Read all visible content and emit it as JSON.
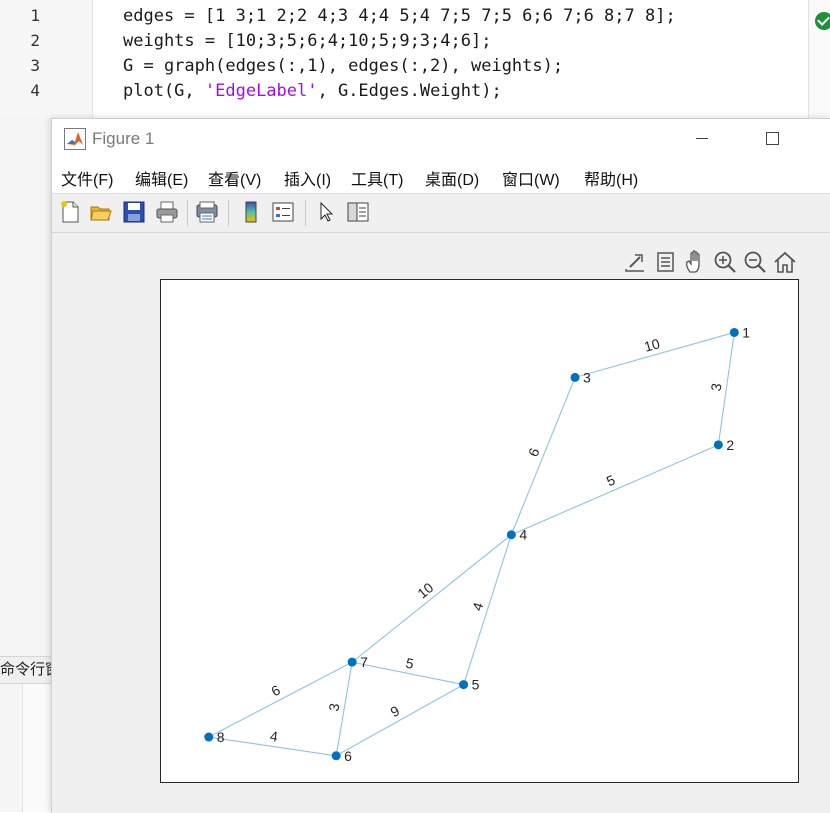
{
  "editor": {
    "lines": [
      {
        "num": "1",
        "segments": [
          {
            "text": "edges = [1 3;1 2;2 4;3 4;4 5;4 7;5 7;5 6;6 7;6 8;7 8];"
          }
        ]
      },
      {
        "num": "2",
        "segments": [
          {
            "text": "weights = [10;3;5;6;4;10;5;9;3;4;6];"
          }
        ]
      },
      {
        "num": "3",
        "segments": [
          {
            "text": "G = graph(edges(:,1), edges(:,2), weights);"
          }
        ]
      },
      {
        "num": "4",
        "segments": [
          {
            "text": "plot(G, "
          },
          {
            "text": "'EdgeLabel'",
            "string": true
          },
          {
            "text": ", G.Edges.Weight);"
          }
        ]
      }
    ],
    "status_icon": "check-circle-icon"
  },
  "command_window": {
    "label": "命令行窗口"
  },
  "figure": {
    "title": "Figure 1",
    "menu": [
      "文件(F)",
      "编辑(E)",
      "查看(V)",
      "插入(I)",
      "工具(T)",
      "桌面(D)",
      "窗口(W)",
      "帮助(H)"
    ],
    "toolbar_icons": [
      "new-figure-icon",
      "open-file-icon",
      "save-icon",
      "print-icon",
      "print-preview-icon",
      "colorbar-icon",
      "legend-icon",
      "pointer-icon",
      "property-inspector-icon"
    ],
    "axes_toolbar_icons": [
      "export-icon",
      "data-tips-icon",
      "pan-icon",
      "zoom-in-icon",
      "zoom-out-icon",
      "home-icon"
    ]
  },
  "colors": {
    "node": "#0072bd",
    "edge": "#8fc3e6",
    "string": "#a709f5"
  },
  "chart_data": {
    "type": "graph",
    "nodes": [
      {
        "id": "1",
        "x": 3.6,
        "y": 6.0
      },
      {
        "id": "2",
        "x": 3.5,
        "y": 4.5
      },
      {
        "id": "3",
        "x": 2.6,
        "y": 5.4
      },
      {
        "id": "4",
        "x": 2.2,
        "y": 3.3
      },
      {
        "id": "5",
        "x": 1.9,
        "y": 1.3
      },
      {
        "id": "6",
        "x": 1.1,
        "y": 0.35
      },
      {
        "id": "7",
        "x": 1.2,
        "y": 1.6
      },
      {
        "id": "8",
        "x": 0.3,
        "y": 0.6
      }
    ],
    "edges": [
      {
        "source": "1",
        "target": "3",
        "weight": "10"
      },
      {
        "source": "1",
        "target": "2",
        "weight": "3"
      },
      {
        "source": "2",
        "target": "4",
        "weight": "5"
      },
      {
        "source": "3",
        "target": "4",
        "weight": "6"
      },
      {
        "source": "4",
        "target": "5",
        "weight": "4"
      },
      {
        "source": "4",
        "target": "7",
        "weight": "10"
      },
      {
        "source": "5",
        "target": "7",
        "weight": "5"
      },
      {
        "source": "5",
        "target": "6",
        "weight": "9"
      },
      {
        "source": "6",
        "target": "7",
        "weight": "3"
      },
      {
        "source": "6",
        "target": "8",
        "weight": "4"
      },
      {
        "source": "7",
        "target": "8",
        "weight": "6"
      }
    ],
    "xlim": [
      0,
      4
    ],
    "ylim": [
      0,
      6.7
    ],
    "grid": false,
    "axis_ticks": false
  }
}
